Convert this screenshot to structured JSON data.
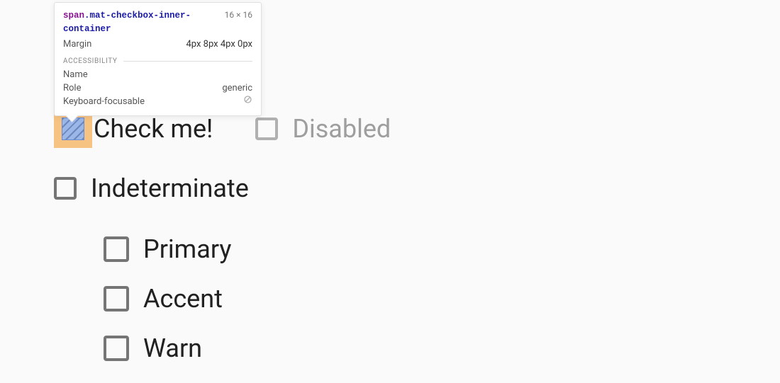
{
  "tooltip": {
    "selector_tag": "span",
    "selector_class": ".mat-checkbox-inner-container",
    "dims": "16 × 16",
    "margin_label": "Margin",
    "margin_value": "4px 8px 4px 0px",
    "accessibility_label": "ACCESSIBILITY",
    "a11y": {
      "name_label": "Name",
      "role_label": "Role",
      "role_value": "generic",
      "focusable_label": "Keyboard-focusable"
    }
  },
  "checkboxes": {
    "check_me": "Check me!",
    "disabled": "Disabled",
    "indeterminate": "Indeterminate",
    "primary": "Primary",
    "accent": "Accent",
    "warn": "Warn"
  }
}
